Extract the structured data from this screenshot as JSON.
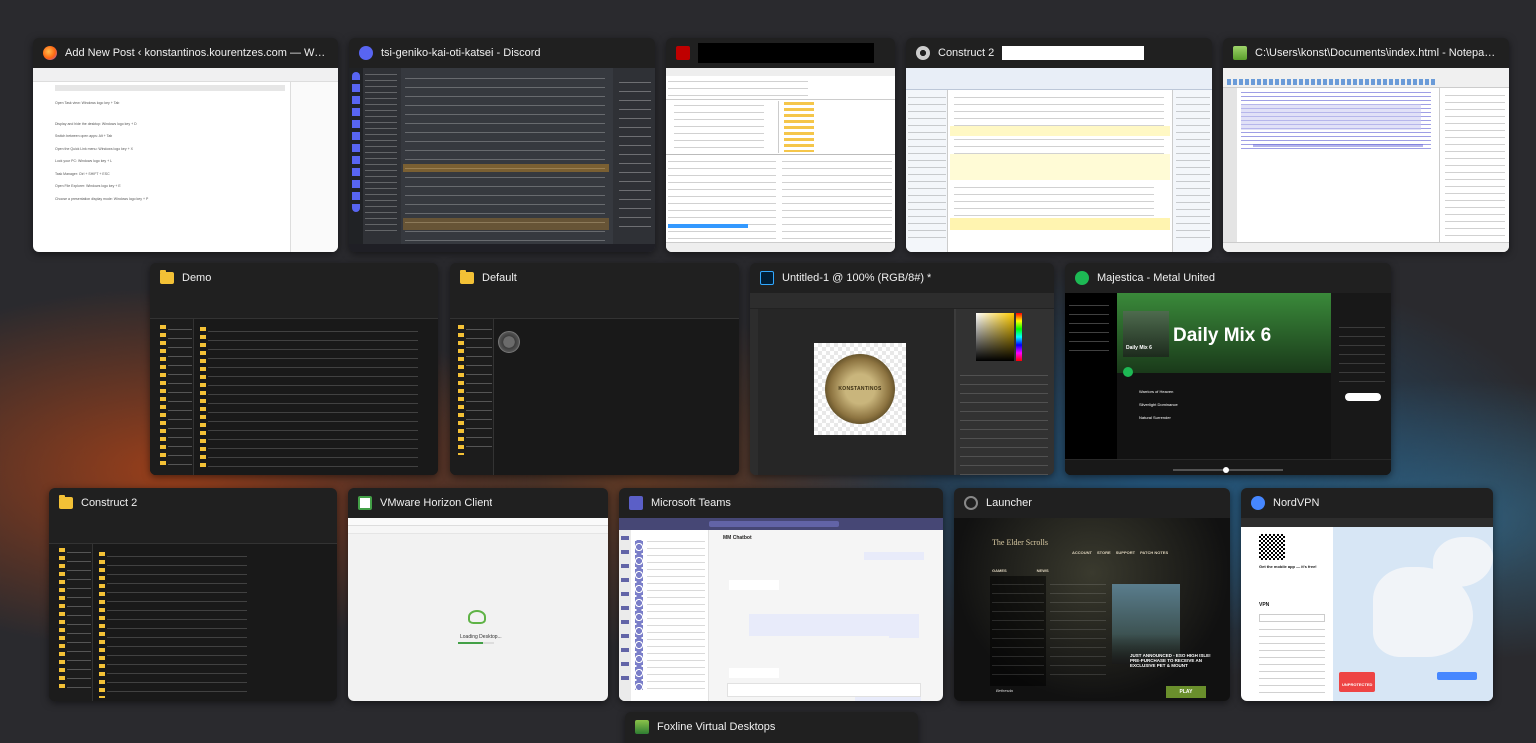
{
  "colors": {
    "background": "#2a2a2e",
    "window_frame": "#202020",
    "discord_blurple": "#5865f2",
    "spotify_green": "#1db954",
    "teams_purple": "#464775",
    "nordvpn_blue": "#4687ff",
    "folder_yellow": "#f3c136"
  },
  "windows": [
    {
      "id": "wordpress",
      "title": "Add New Post ‹ konstantinos.kourentzes.com — Word...",
      "icon": "firefox-icon"
    },
    {
      "id": "discord",
      "title": "tsi-geniko-kai-oti-katsei - Discord",
      "icon": "discord-icon"
    },
    {
      "id": "filezilla",
      "title": "",
      "icon": "filezilla-icon"
    },
    {
      "id": "construct2-app",
      "title": "Construct 2",
      "icon": "gear-icon"
    },
    {
      "id": "notepadpp",
      "title": "C:\\Users\\konst\\Documents\\index.html - Notepad...",
      "icon": "notepad-icon"
    },
    {
      "id": "demo",
      "title": "Demo",
      "icon": "folder-icon"
    },
    {
      "id": "default",
      "title": "Default",
      "icon": "folder-icon"
    },
    {
      "id": "photoshop",
      "title": "Untitled-1 @ 100% (RGB/8#) *",
      "icon": "photoshop-icon"
    },
    {
      "id": "spotify",
      "title": "Majestica - Metal United",
      "icon": "spotify-icon"
    },
    {
      "id": "construct2-folder",
      "title": "Construct 2",
      "icon": "folder-icon"
    },
    {
      "id": "vmware",
      "title": "VMware Horizon Client",
      "icon": "vmware-icon"
    },
    {
      "id": "teams",
      "title": "Microsoft Teams",
      "icon": "teams-icon"
    },
    {
      "id": "launcher",
      "title": "Launcher",
      "icon": "launcher-icon"
    },
    {
      "id": "nordvpn",
      "title": "NordVPN",
      "icon": "nordvpn-icon"
    },
    {
      "id": "foxline",
      "title": "Foxline Virtual Desktops",
      "icon": "foxline-icon"
    }
  ],
  "thumbs": {
    "wordpress": {
      "lines": [
        "Open Task view: Windows logo key + Tab",
        "Display and hide the desktop: Windows logo key + D",
        "Switch between open apps: Alt + Tab",
        "Open the Quick Link menu: Windows logo key + X",
        "Lock your PC: Windows logo key + L",
        "Task Manager: Ctrl + SHIFT + ESC",
        "Open File Explorer: Windows logo key + E",
        "Choose a presentation display mode: Windows logo key + P"
      ]
    },
    "spotify": {
      "playlist_title": "Daily Mix 6",
      "cover_label": "Daily Mix 6",
      "tracks": [
        "Warriors of Heaven",
        "Silverlight Dominance",
        "Natural Surrender"
      ]
    },
    "photoshop": {
      "logo_text": "KONSTANTINOS"
    },
    "vmware": {
      "loading": "Loading Desktop..."
    },
    "teams": {
      "chat_title": "MM Chatbot"
    },
    "launcher": {
      "game_title": "The Elder Scrolls",
      "nav": [
        "ACCOUNT",
        "STORE",
        "SUPPORT",
        "PATCH NOTES"
      ],
      "tabs": [
        "GAMES",
        "NEWS"
      ],
      "promo": "JUST ANNOUNCED - ESO HIGH ISLE! PRE-PURCHASE TO RECEIVE AN EXCLUSIVE PET & MOUNT",
      "play": "PLAY",
      "publisher": "Bethesda"
    },
    "nordvpn": {
      "section": "VPN",
      "promo": "Get the mobile app — it's free!",
      "status": "UNPROTECTED"
    }
  }
}
